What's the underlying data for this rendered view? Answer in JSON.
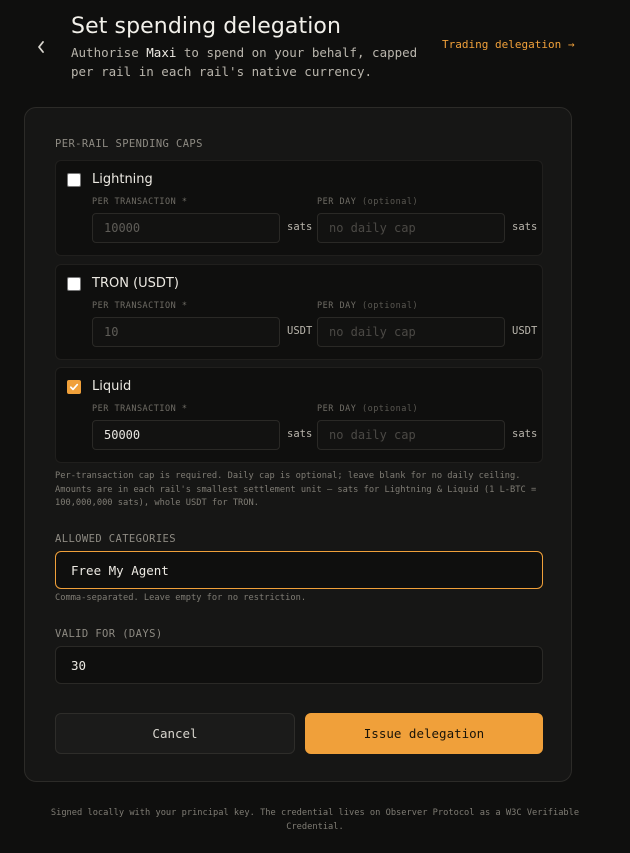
{
  "header": {
    "title": "Set spending delegation",
    "subtitle_prefix": "Authorise ",
    "subtitle_agent": "Maxi",
    "subtitle_suffix": " to spend on your behalf, capped per rail in each rail's native currency.",
    "trading_link": "Trading delegation →"
  },
  "caps": {
    "section_label": "PER-RAIL SPENDING CAPS",
    "per_tx_label": "PER TRANSACTION *",
    "per_day_label": "PER DAY",
    "optional_label": "(optional)",
    "daily_placeholder": "no daily cap",
    "rails": [
      {
        "name": "Lightning",
        "checked": false,
        "per_tx": "10000",
        "unit": "sats"
      },
      {
        "name": "TRON (USDT)",
        "checked": false,
        "per_tx": "10",
        "unit": "USDT"
      },
      {
        "name": "Liquid",
        "checked": true,
        "per_tx": "50000",
        "unit": "sats"
      }
    ],
    "help": "Per-transaction cap is required. Daily cap is optional; leave blank for no daily ceiling. Amounts are in each rail's smallest settlement unit — sats for Lightning & Liquid (1 L-BTC = 100,000,000 sats), whole USDT for TRON."
  },
  "categories": {
    "label": "ALLOWED CATEGORIES",
    "value": "Free My Agent",
    "help": "Comma-separated. Leave empty for no restriction."
  },
  "validity": {
    "label": "VALID FOR (DAYS)",
    "value": "30"
  },
  "actions": {
    "cancel": "Cancel",
    "issue": "Issue delegation"
  },
  "footer": "Signed locally with your principal key. The credential lives on Observer Protocol as a W3C Verifiable Credential.",
  "colors": {
    "accent": "#f0a03a",
    "background": "#0f0f0e",
    "card": "#161615"
  }
}
